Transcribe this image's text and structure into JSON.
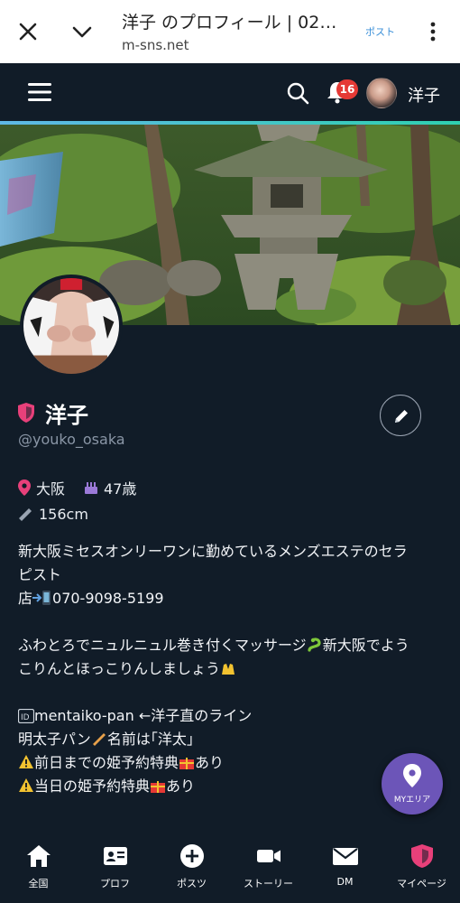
{
  "browser": {
    "title": "洋子 のプロフィール | 02…",
    "url": "m-sns.net",
    "post_link": "ポスト"
  },
  "header": {
    "notification_count": "16",
    "user_name": "洋子"
  },
  "profile": {
    "name": "洋子",
    "handle": "@youko_osaka",
    "location": "大阪",
    "age": "47歳",
    "height": "156cm"
  },
  "bio": {
    "line1": "新大阪ミセスオンリーワンに勤めているメンズエステのセラ",
    "line2": "ピスト",
    "line3_prefix": "店",
    "line3_phone": "070-9098-5199",
    "line5a": "ふわとろでニュルニュル巻き付くマッサージ",
    "line5b": "新大阪でよう",
    "line6": "こりんとほっこりんしましょう",
    "line8": "mentaiko-pan ←洋子直のライン",
    "line9a": "明太子パン",
    "line9b": "名前は｢洋太｣",
    "line10a": "前日までの姫予約特典",
    "line10b": "あり",
    "line11a": "当日の姫予約特典",
    "line11b": "あり"
  },
  "fab": {
    "label": "MYエリア"
  },
  "nav": {
    "items": [
      {
        "label": "全国"
      },
      {
        "label": "プロフ"
      },
      {
        "label": "ポスツ"
      },
      {
        "label": "ストーリー"
      },
      {
        "label": "DM"
      },
      {
        "label": "マイページ"
      }
    ]
  },
  "colors": {
    "background": "#111c28",
    "accent_pink": "#e8407a",
    "fab_purple": "#6c55b8",
    "badge_red": "#e53935",
    "accent_line": "#2fd0b0"
  }
}
